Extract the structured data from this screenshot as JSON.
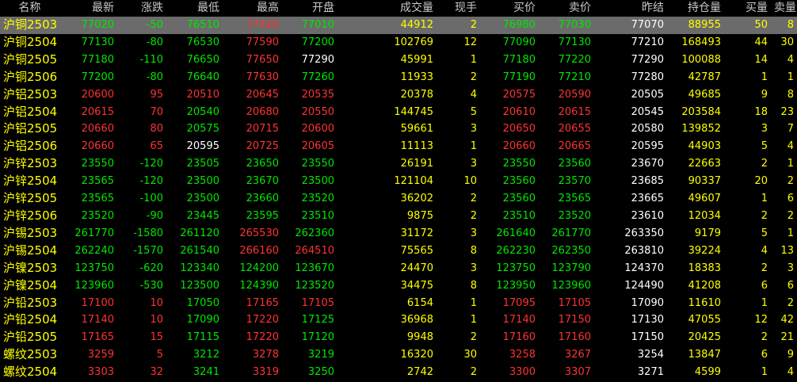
{
  "colors": {
    "up": "#ff3232",
    "down": "#00e600",
    "flat": "#ffffff",
    "volume": "#ffff00",
    "header": "#c8c8c8",
    "selected_row": "#6b6b6b"
  },
  "columns": [
    "名称",
    "最新",
    "涨跌",
    "最低",
    "最高",
    "开盘",
    "成交量",
    "现手",
    "买价",
    "卖价",
    "昨结",
    "持仓量",
    "买量",
    "卖量"
  ],
  "rows": [
    {
      "name": "沪铜2503",
      "last": "77020",
      "change": "-50",
      "low": "76510",
      "high": "77420",
      "open": "77010",
      "volume": "44912",
      "hand": "2",
      "bid": "76980",
      "ask": "77030",
      "prev": "77070",
      "oi": "88955",
      "bidv": "50",
      "askv": "8",
      "selected": true
    },
    {
      "name": "沪铜2504",
      "last": "77130",
      "change": "-80",
      "low": "76530",
      "high": "77590",
      "open": "77200",
      "volume": "102769",
      "hand": "12",
      "bid": "77090",
      "ask": "77130",
      "prev": "77210",
      "oi": "168493",
      "bidv": "44",
      "askv": "30"
    },
    {
      "name": "沪铜2505",
      "last": "77180",
      "change": "-110",
      "low": "76650",
      "high": "77650",
      "open": "77290",
      "volume": "45991",
      "hand": "1",
      "bid": "77180",
      "ask": "77220",
      "prev": "77290",
      "oi": "100088",
      "bidv": "14",
      "askv": "4"
    },
    {
      "name": "沪铜2506",
      "last": "77200",
      "change": "-80",
      "low": "76640",
      "high": "77630",
      "open": "77260",
      "volume": "11933",
      "hand": "2",
      "bid": "77190",
      "ask": "77210",
      "prev": "77280",
      "oi": "42787",
      "bidv": "1",
      "askv": "1"
    },
    {
      "name": "沪铝2503",
      "last": "20600",
      "change": "95",
      "low": "20510",
      "high": "20645",
      "open": "20535",
      "volume": "20378",
      "hand": "4",
      "bid": "20575",
      "ask": "20590",
      "prev": "20505",
      "oi": "49685",
      "bidv": "9",
      "askv": "8"
    },
    {
      "name": "沪铝2504",
      "last": "20615",
      "change": "70",
      "low": "20540",
      "high": "20680",
      "open": "20550",
      "volume": "144745",
      "hand": "5",
      "bid": "20610",
      "ask": "20615",
      "prev": "20545",
      "oi": "203584",
      "bidv": "18",
      "askv": "23"
    },
    {
      "name": "沪铝2505",
      "last": "20660",
      "change": "80",
      "low": "20575",
      "high": "20715",
      "open": "20600",
      "volume": "59661",
      "hand": "3",
      "bid": "20650",
      "ask": "20655",
      "prev": "20580",
      "oi": "139852",
      "bidv": "3",
      "askv": "7"
    },
    {
      "name": "沪铝2506",
      "last": "20660",
      "change": "65",
      "low": "20595",
      "high": "20725",
      "open": "20605",
      "volume": "11113",
      "hand": "1",
      "bid": "20660",
      "ask": "20665",
      "prev": "20595",
      "oi": "44903",
      "bidv": "5",
      "askv": "4"
    },
    {
      "name": "沪锌2503",
      "last": "23550",
      "change": "-120",
      "low": "23505",
      "high": "23650",
      "open": "23550",
      "volume": "26191",
      "hand": "3",
      "bid": "23550",
      "ask": "23560",
      "prev": "23670",
      "oi": "22663",
      "bidv": "2",
      "askv": "1"
    },
    {
      "name": "沪锌2504",
      "last": "23565",
      "change": "-120",
      "low": "23500",
      "high": "23670",
      "open": "23500",
      "volume": "121104",
      "hand": "10",
      "bid": "23560",
      "ask": "23570",
      "prev": "23685",
      "oi": "90337",
      "bidv": "20",
      "askv": "2"
    },
    {
      "name": "沪锌2505",
      "last": "23565",
      "change": "-100",
      "low": "23500",
      "high": "23660",
      "open": "23520",
      "volume": "36202",
      "hand": "2",
      "bid": "23560",
      "ask": "23565",
      "prev": "23665",
      "oi": "49607",
      "bidv": "1",
      "askv": "6"
    },
    {
      "name": "沪锌2506",
      "last": "23520",
      "change": "-90",
      "low": "23445",
      "high": "23595",
      "open": "23510",
      "volume": "9875",
      "hand": "2",
      "bid": "23510",
      "ask": "23520",
      "prev": "23610",
      "oi": "12034",
      "bidv": "2",
      "askv": "2"
    },
    {
      "name": "沪锡2503",
      "last": "261770",
      "change": "-1580",
      "low": "261120",
      "high": "265530",
      "open": "262360",
      "volume": "31172",
      "hand": "3",
      "bid": "261640",
      "ask": "261770",
      "prev": "263350",
      "oi": "9179",
      "bidv": "5",
      "askv": "1"
    },
    {
      "name": "沪锡2504",
      "last": "262240",
      "change": "-1570",
      "low": "261540",
      "high": "266160",
      "open": "264510",
      "volume": "75565",
      "hand": "8",
      "bid": "262230",
      "ask": "262350",
      "prev": "263810",
      "oi": "39224",
      "bidv": "4",
      "askv": "13"
    },
    {
      "name": "沪镍2503",
      "last": "123750",
      "change": "-620",
      "low": "123340",
      "high": "124200",
      "open": "123670",
      "volume": "24470",
      "hand": "3",
      "bid": "123750",
      "ask": "123790",
      "prev": "124370",
      "oi": "18383",
      "bidv": "2",
      "askv": "3"
    },
    {
      "name": "沪镍2504",
      "last": "123960",
      "change": "-530",
      "low": "123500",
      "high": "124390",
      "open": "123520",
      "volume": "34475",
      "hand": "8",
      "bid": "123950",
      "ask": "123960",
      "prev": "124490",
      "oi": "41208",
      "bidv": "6",
      "askv": "6"
    },
    {
      "name": "沪铅2503",
      "last": "17100",
      "change": "10",
      "low": "17050",
      "high": "17165",
      "open": "17105",
      "volume": "6154",
      "hand": "1",
      "bid": "17095",
      "ask": "17105",
      "prev": "17090",
      "oi": "11610",
      "bidv": "1",
      "askv": "2"
    },
    {
      "name": "沪铅2504",
      "last": "17140",
      "change": "10",
      "low": "17090",
      "high": "17220",
      "open": "17125",
      "volume": "36968",
      "hand": "1",
      "bid": "17140",
      "ask": "17150",
      "prev": "17130",
      "oi": "47055",
      "bidv": "12",
      "askv": "42"
    },
    {
      "name": "沪铅2505",
      "last": "17165",
      "change": "15",
      "low": "17115",
      "high": "17220",
      "open": "17120",
      "volume": "9948",
      "hand": "2",
      "bid": "17160",
      "ask": "17160",
      "prev": "17150",
      "oi": "20425",
      "bidv": "2",
      "askv": "21"
    },
    {
      "name": "螺纹2503",
      "last": "3259",
      "change": "5",
      "low": "3212",
      "high": "3278",
      "open": "3219",
      "volume": "16320",
      "hand": "30",
      "bid": "3258",
      "ask": "3267",
      "prev": "3254",
      "oi": "13847",
      "bidv": "6",
      "askv": "9"
    },
    {
      "name": "螺纹2504",
      "last": "3303",
      "change": "32",
      "low": "3241",
      "high": "3319",
      "open": "3250",
      "volume": "2742",
      "hand": "2",
      "bid": "3300",
      "ask": "3307",
      "prev": "3271",
      "oi": "4599",
      "bidv": "1",
      "askv": "4"
    }
  ]
}
